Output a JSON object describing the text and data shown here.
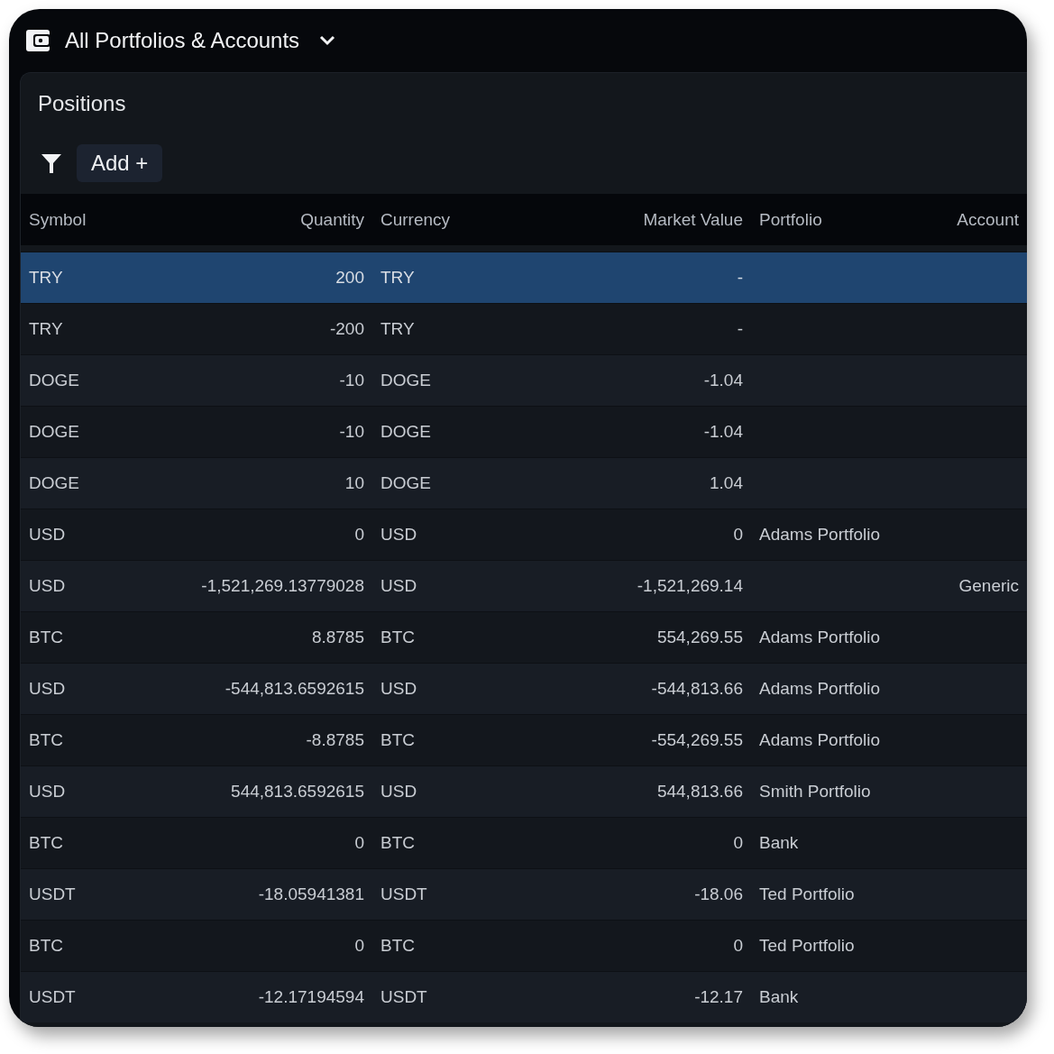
{
  "header": {
    "title": "All Portfolios & Accounts"
  },
  "panel": {
    "title": "Positions",
    "add_button": "Add +"
  },
  "table": {
    "columns": [
      "Symbol",
      "Quantity",
      "Currency",
      "Market Value",
      "Portfolio",
      "Account"
    ],
    "rows": [
      {
        "selected": true,
        "symbol": "TRY",
        "quantity": "200",
        "currency": "TRY",
        "market_value": "-"
      },
      {
        "selected": false,
        "symbol": "TRY",
        "quantity": "-200",
        "currency": "TRY",
        "market_value": "-"
      },
      {
        "selected": false,
        "symbol": "DOGE",
        "quantity": "-10",
        "currency": "DOGE",
        "market_value": "-1.04"
      },
      {
        "selected": false,
        "symbol": "DOGE",
        "quantity": "-10",
        "currency": "DOGE",
        "market_value": "-1.04"
      },
      {
        "selected": false,
        "symbol": "DOGE",
        "quantity": "10",
        "currency": "DOGE",
        "market_value": "1.04"
      },
      {
        "selected": false,
        "symbol": "USD",
        "quantity": "0",
        "currency": "USD",
        "market_value": "0",
        "portfolio": "Adams Portfolio"
      },
      {
        "selected": false,
        "symbol": "USD",
        "quantity": "-1,521,269.13779028",
        "currency": "USD",
        "market_value": "-1,521,269.14",
        "account": "Generic"
      },
      {
        "selected": false,
        "symbol": "BTC",
        "quantity": "8.8785",
        "currency": "BTC",
        "market_value": "554,269.55",
        "portfolio": "Adams Portfolio"
      },
      {
        "selected": false,
        "symbol": "USD",
        "quantity": "-544,813.6592615",
        "currency": "USD",
        "market_value": "-544,813.66",
        "portfolio": "Adams Portfolio"
      },
      {
        "selected": false,
        "symbol": "BTC",
        "quantity": "-8.8785",
        "currency": "BTC",
        "market_value": "-554,269.55",
        "portfolio": "Adams Portfolio"
      },
      {
        "selected": false,
        "symbol": "USD",
        "quantity": "544,813.6592615",
        "currency": "USD",
        "market_value": "544,813.66",
        "portfolio": "Smith Portfolio"
      },
      {
        "selected": false,
        "symbol": "BTC",
        "quantity": "0",
        "currency": "BTC",
        "market_value": "0",
        "portfolio": "Bank"
      },
      {
        "selected": false,
        "symbol": "USDT",
        "quantity": "-18.05941381",
        "currency": "USDT",
        "market_value": "-18.06",
        "portfolio": "Ted Portfolio"
      },
      {
        "selected": false,
        "symbol": "BTC",
        "quantity": "0",
        "currency": "BTC",
        "market_value": "0",
        "portfolio": "Ted Portfolio"
      },
      {
        "selected": false,
        "symbol": "USDT",
        "quantity": "-12.17194594",
        "currency": "USDT",
        "market_value": "-12.17",
        "portfolio": "Bank"
      }
    ]
  }
}
